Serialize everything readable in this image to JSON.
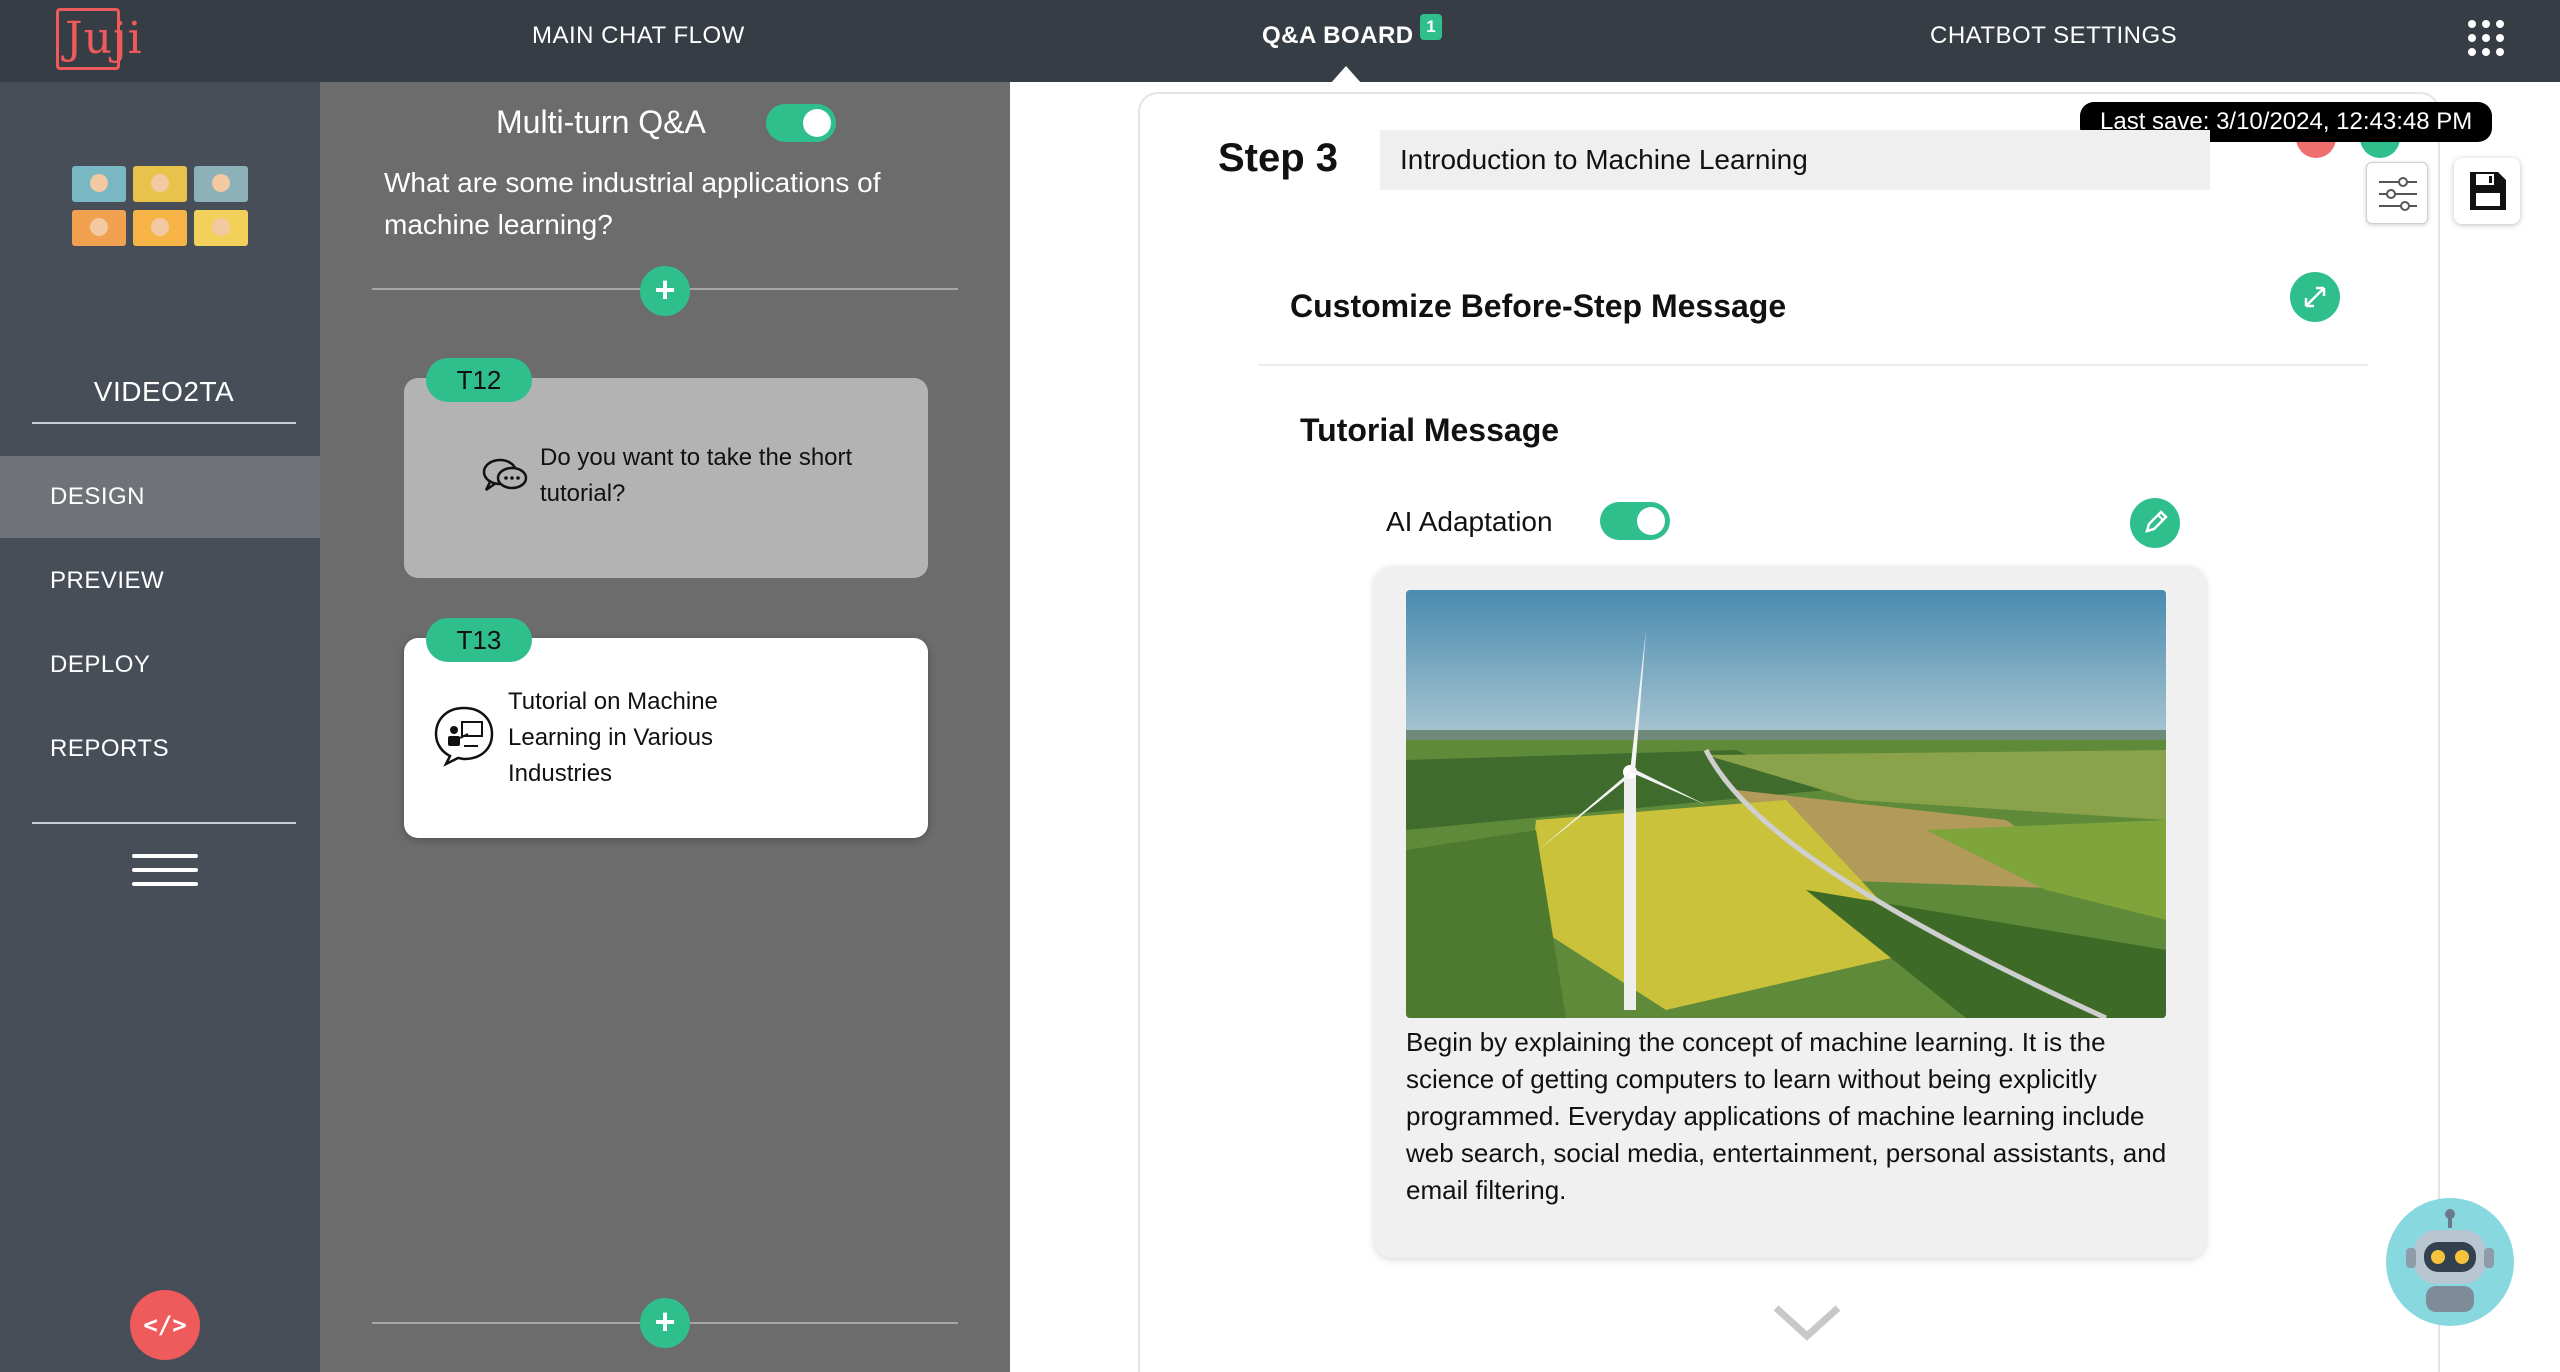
{
  "app": {
    "logo_text": "Juji"
  },
  "topnav": {
    "main_chat_flow": "MAIN CHAT FLOW",
    "qa_board": "Q&A BOARD",
    "qa_badge": "1",
    "chatbot_settings": "CHATBOT SETTINGS"
  },
  "sidebar": {
    "project_name": "VIDEO2TA",
    "items": [
      {
        "label": "DESIGN",
        "active": true
      },
      {
        "label": "PREVIEW"
      },
      {
        "label": "DEPLOY"
      },
      {
        "label": "REPORTS"
      }
    ],
    "code_button": "</>"
  },
  "qa_panel": {
    "multi_turn_label": "Multi-turn Q&A",
    "multi_turn_enabled": true,
    "question": "What are some industrial applications of machine learning?",
    "add_symbol": "+",
    "cards": [
      {
        "tag": "T12",
        "icon": "chat-bubbles-icon",
        "text": "Do you want to take the short tutorial?",
        "selected": false
      },
      {
        "tag": "T13",
        "icon": "tutorial-presentation-icon",
        "text": "Tutorial on Machine Learning in Various Industries",
        "selected": true
      }
    ]
  },
  "main": {
    "last_save": "Last save: 3/10/2024, 12:43:48 PM",
    "step_label": "Step 3",
    "step_title": "Introduction to Machine Learning",
    "before_step_title": "Customize Before-Step Message",
    "tutorial_title": "Tutorial Message",
    "ai_adaptation_label": "AI Adaptation",
    "ai_adaptation_enabled": true,
    "message_image": "wind-turbine-landscape-image",
    "message_text": "Begin by explaining the concept of machine learning. It is the science of getting computers to learn without being explicitly programmed. Everyday applications of machine learning include web search, social media, entertainment, personal assistants, and email filtering."
  },
  "colors": {
    "accent": "#2fbf8c",
    "brand_red": "#ef5a5a",
    "topbar": "#373d44",
    "sidebar": "#474e58",
    "mid_panel": "#6c6c6c"
  }
}
